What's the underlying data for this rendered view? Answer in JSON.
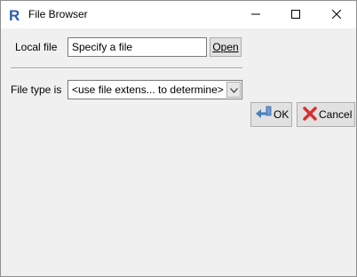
{
  "window": {
    "title": "File Browser",
    "app_icon": "r-logo-icon"
  },
  "titlebar_buttons": {
    "minimize_icon": "minimize-icon",
    "maximize_icon": "maximize-icon",
    "close_icon": "close-icon"
  },
  "local_file": {
    "label": "Local file",
    "value": "Specify a file",
    "open_label": "Open"
  },
  "file_type": {
    "label": "File type is",
    "selected": "<use file extens... to determine>"
  },
  "actions": {
    "ok_label": "OK",
    "ok_icon": "return-arrow-icon",
    "cancel_label": "Cancel",
    "cancel_icon": "red-x-icon"
  },
  "colors": {
    "dialog_background": "#f0f0f0",
    "titlebar_background": "#ffffff",
    "ok_icon_color": "#4a7fc0",
    "cancel_icon_color": "#d83030"
  }
}
